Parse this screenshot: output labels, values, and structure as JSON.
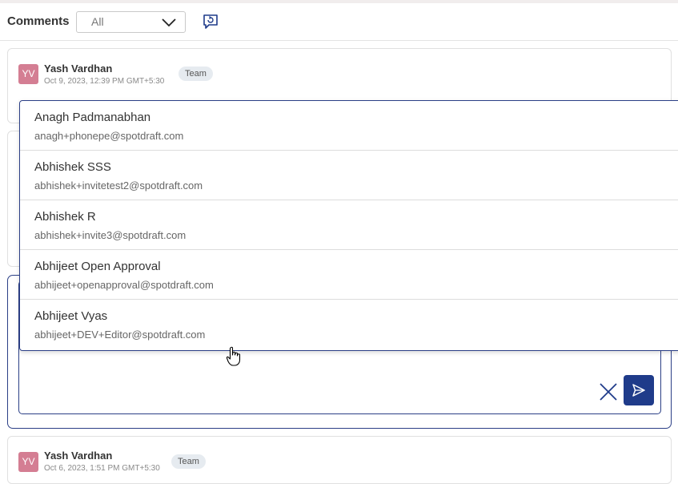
{
  "header": {
    "title": "Comments",
    "filter_value": "All"
  },
  "comments": [
    {
      "initials": "YV",
      "author": "Yash Vardhan",
      "timestamp": "Oct 9, 2023, 12:39 PM GMT+5:30",
      "badge": "Team"
    },
    {
      "initials": "YV",
      "author": "Yash Vardhan",
      "timestamp": "Oct 6, 2023, 1:51 PM GMT+5:30",
      "badge": "Team"
    }
  ],
  "mention_dropdown": {
    "items": [
      {
        "name": "Anagh Padmanabhan",
        "email": "anagh+phonepe@spotdraft.com"
      },
      {
        "name": "Abhishek SSS",
        "email": "abhishek+invitetest2@spotdraft.com"
      },
      {
        "name": "Abhishek R",
        "email": "abhishek+invite3@spotdraft.com"
      },
      {
        "name": "Abhijeet Open Approval",
        "email": "abhijeet+openapproval@spotdraft.com"
      },
      {
        "name": "Abhijeet Vyas",
        "email": "abhijeet+DEV+Editor@spotdraft.com"
      }
    ]
  },
  "colors": {
    "accent": "#1f3b8a",
    "avatar": "#d47e93",
    "badge_bg": "#e6ebf0"
  },
  "icons": {
    "filter_chevron": "chevron-down-icon",
    "refresh": "comment-refresh-icon",
    "cancel": "close-icon",
    "send": "send-icon"
  }
}
